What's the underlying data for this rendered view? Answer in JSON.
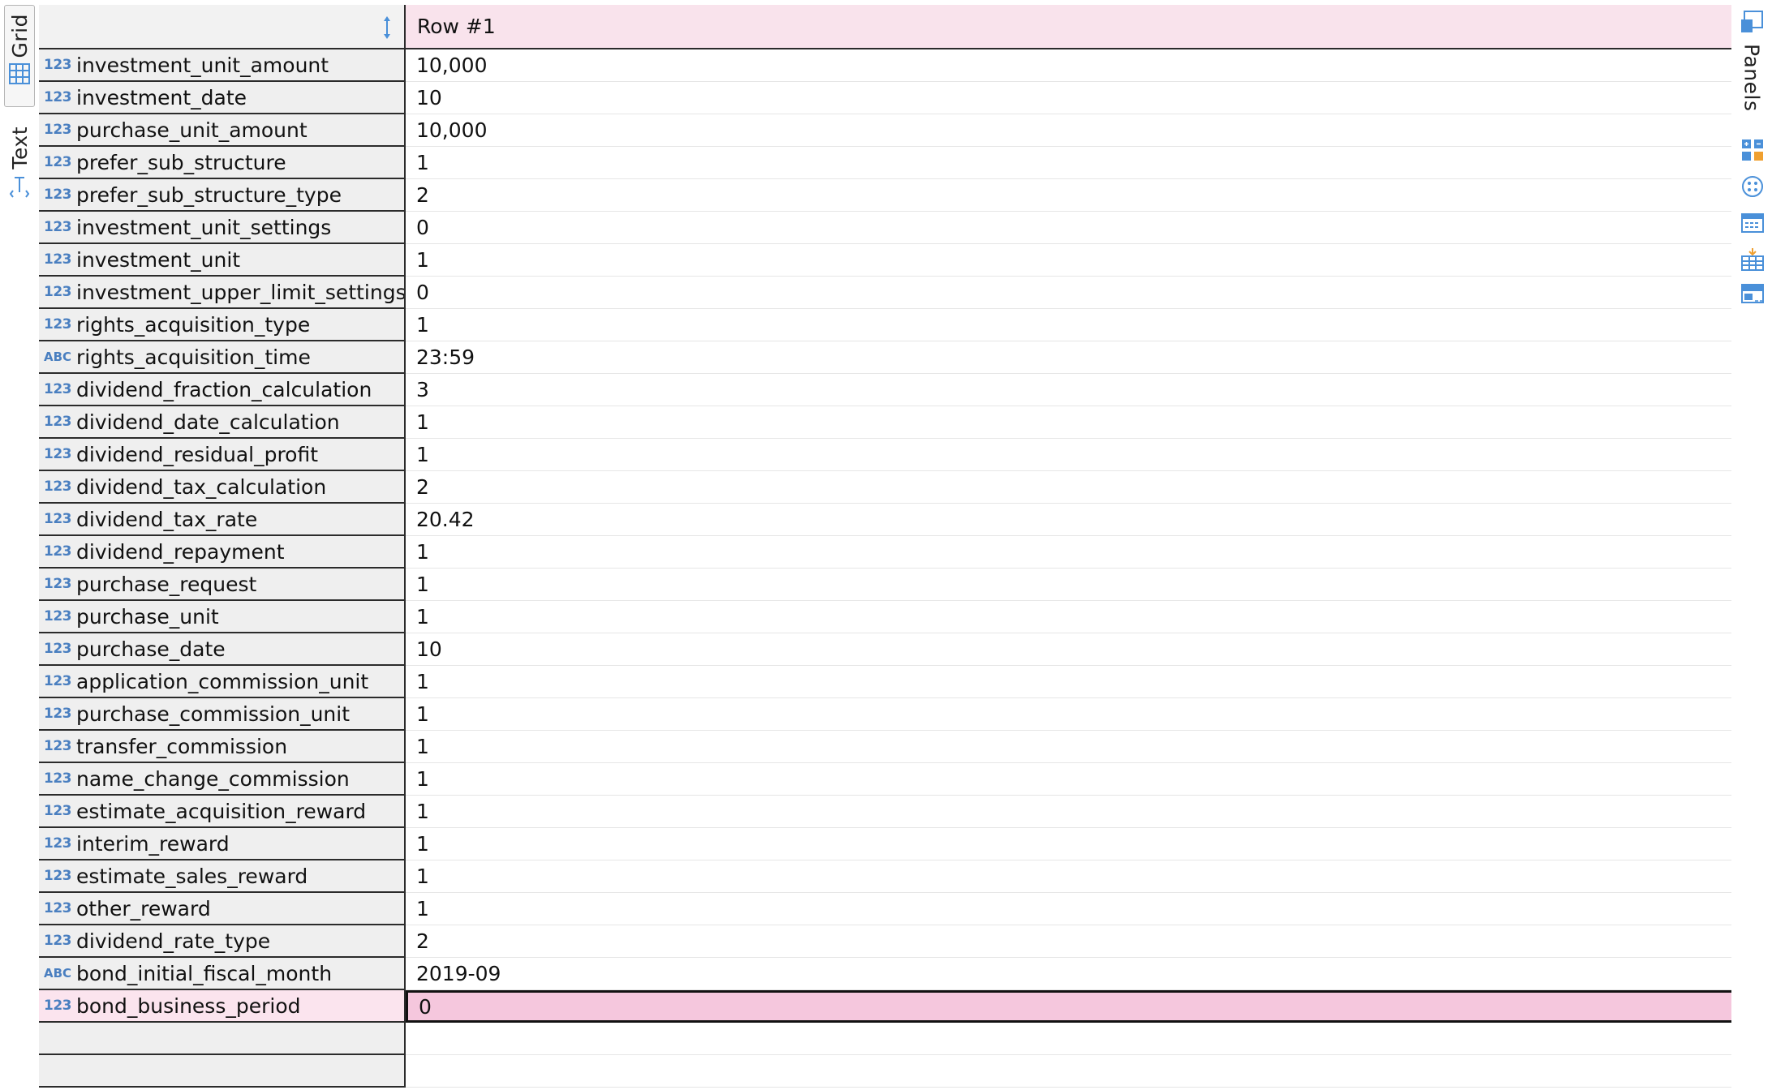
{
  "left_tabs": {
    "grid_label": "Grid",
    "text_label": "Text"
  },
  "right_panel": {
    "panels_label": "Panels"
  },
  "grid": {
    "column_header": "Row  #1",
    "rows": [
      {
        "type": "123",
        "name": "investment_unit_amount",
        "value": "10,000"
      },
      {
        "type": "123",
        "name": "investment_date",
        "value": "10"
      },
      {
        "type": "123",
        "name": "purchase_unit_amount",
        "value": "10,000"
      },
      {
        "type": "123",
        "name": "prefer_sub_structure",
        "value": "1"
      },
      {
        "type": "123",
        "name": "prefer_sub_structure_type",
        "value": "2"
      },
      {
        "type": "123",
        "name": "investment_unit_settings",
        "value": "0"
      },
      {
        "type": "123",
        "name": "investment_unit",
        "value": "1"
      },
      {
        "type": "123",
        "name": "investment_upper_limit_settings",
        "value": "0"
      },
      {
        "type": "123",
        "name": "rights_acquisition_type",
        "value": "1"
      },
      {
        "type": "ABC",
        "name": "rights_acquisition_time",
        "value": "23:59"
      },
      {
        "type": "123",
        "name": "dividend_fraction_calculation",
        "value": "3"
      },
      {
        "type": "123",
        "name": "dividend_date_calculation",
        "value": "1"
      },
      {
        "type": "123",
        "name": "dividend_residual_profit",
        "value": "1"
      },
      {
        "type": "123",
        "name": "dividend_tax_calculation",
        "value": "2"
      },
      {
        "type": "123",
        "name": "dividend_tax_rate",
        "value": "20.42"
      },
      {
        "type": "123",
        "name": "dividend_repayment",
        "value": "1"
      },
      {
        "type": "123",
        "name": "purchase_request",
        "value": "1"
      },
      {
        "type": "123",
        "name": "purchase_unit",
        "value": "1"
      },
      {
        "type": "123",
        "name": "purchase_date",
        "value": "10"
      },
      {
        "type": "123",
        "name": "application_commission_unit",
        "value": "1"
      },
      {
        "type": "123",
        "name": "purchase_commission_unit",
        "value": "1"
      },
      {
        "type": "123",
        "name": "transfer_commission",
        "value": "1"
      },
      {
        "type": "123",
        "name": "name_change_commission",
        "value": "1"
      },
      {
        "type": "123",
        "name": "estimate_acquisition_reward",
        "value": "1"
      },
      {
        "type": "123",
        "name": "interim_reward",
        "value": "1"
      },
      {
        "type": "123",
        "name": "estimate_sales_reward",
        "value": "1"
      },
      {
        "type": "123",
        "name": "other_reward",
        "value": "1"
      },
      {
        "type": "123",
        "name": "dividend_rate_type",
        "value": "2"
      },
      {
        "type": "ABC",
        "name": "bond_initial_fiscal_month",
        "value": "2019-09"
      },
      {
        "type": "123",
        "name": "bond_business_period",
        "value": "0"
      }
    ],
    "selected_index": 29
  },
  "colors": {
    "header_bg": "#f9e3ec",
    "selected_bg": "#f5c7dd",
    "type_badge": "#4a7fc0",
    "accent_icon": "#4a90d9"
  }
}
